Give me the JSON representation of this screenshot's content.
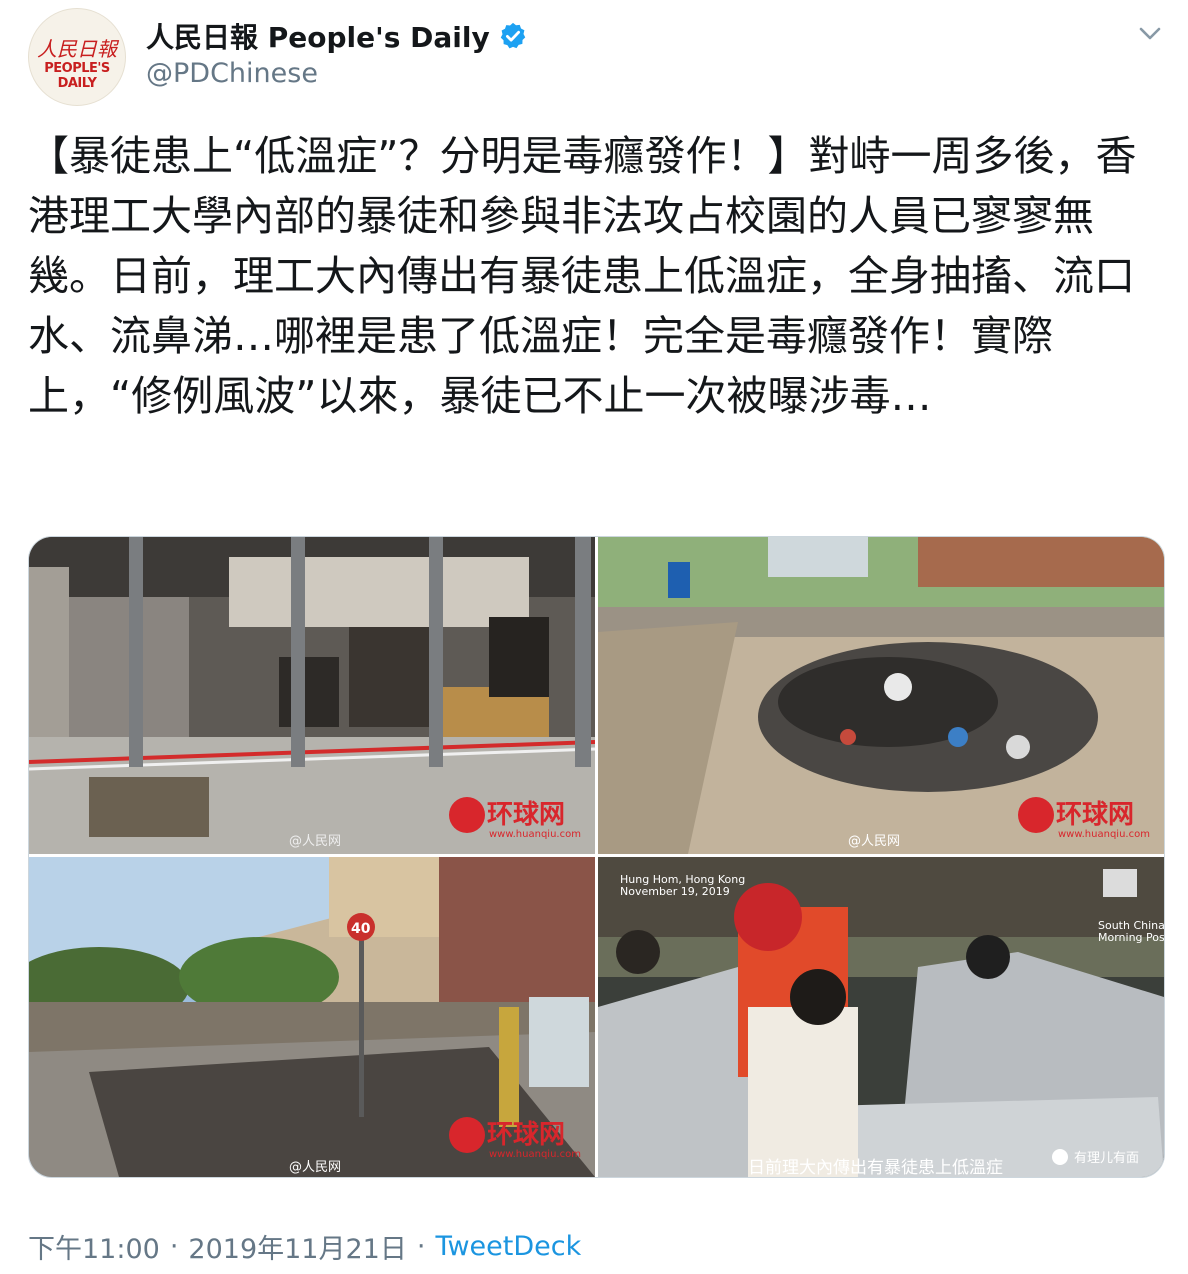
{
  "author": {
    "avatar_logo_cn": "人民日報",
    "avatar_logo_en": "PEOPLE'S DAILY",
    "display_name": "人民日報 People's Daily",
    "handle": "@PDChinese",
    "verified": true
  },
  "tweet": {
    "text": "【暴徒患上“低溫症”？分明是毒癮發作！】對峙一周多後，香港理工大學內部的暴徒和參與非法攻占校園的人員已寥寥無幾。日前，理工大內傳出有暴徒患上低溫症，全身抽搐、流口水、流鼻涕…哪裡是患了低溫症！完全是毒癮發作！實際上，“修例風波”以來，暴徒已不止一次被曝涉毒…"
  },
  "media": {
    "photo1": {
      "watermark_logo": "环球网",
      "watermark_url": "www.huanqiu.com",
      "credit": "@人民网"
    },
    "photo2": {
      "watermark_logo": "环球网",
      "watermark_url": "www.huanqiu.com",
      "credit": "@人民网"
    },
    "photo3": {
      "watermark_logo": "环球网",
      "watermark_url": "www.huanqiu.com",
      "credit": "@人民网",
      "sign_number": "40"
    },
    "photo4": {
      "location": "Hung Hom, Hong Kong",
      "date": "November 19, 2019",
      "scmp_line1": "South China",
      "scmp_line2": "Morning Post",
      "subtitle": "日前理大內傳出有暴徒患上低溫症",
      "wechat_credit": "有理儿有面"
    }
  },
  "meta": {
    "time": "下午11:00",
    "separator": "·",
    "date": "2019年11月21日",
    "source": "TweetDeck"
  },
  "colors": {
    "text": "#14171a",
    "secondary": "#657786",
    "link": "#1b95e0",
    "verified": "#1da1f2",
    "brand_red": "#c81f1f"
  }
}
